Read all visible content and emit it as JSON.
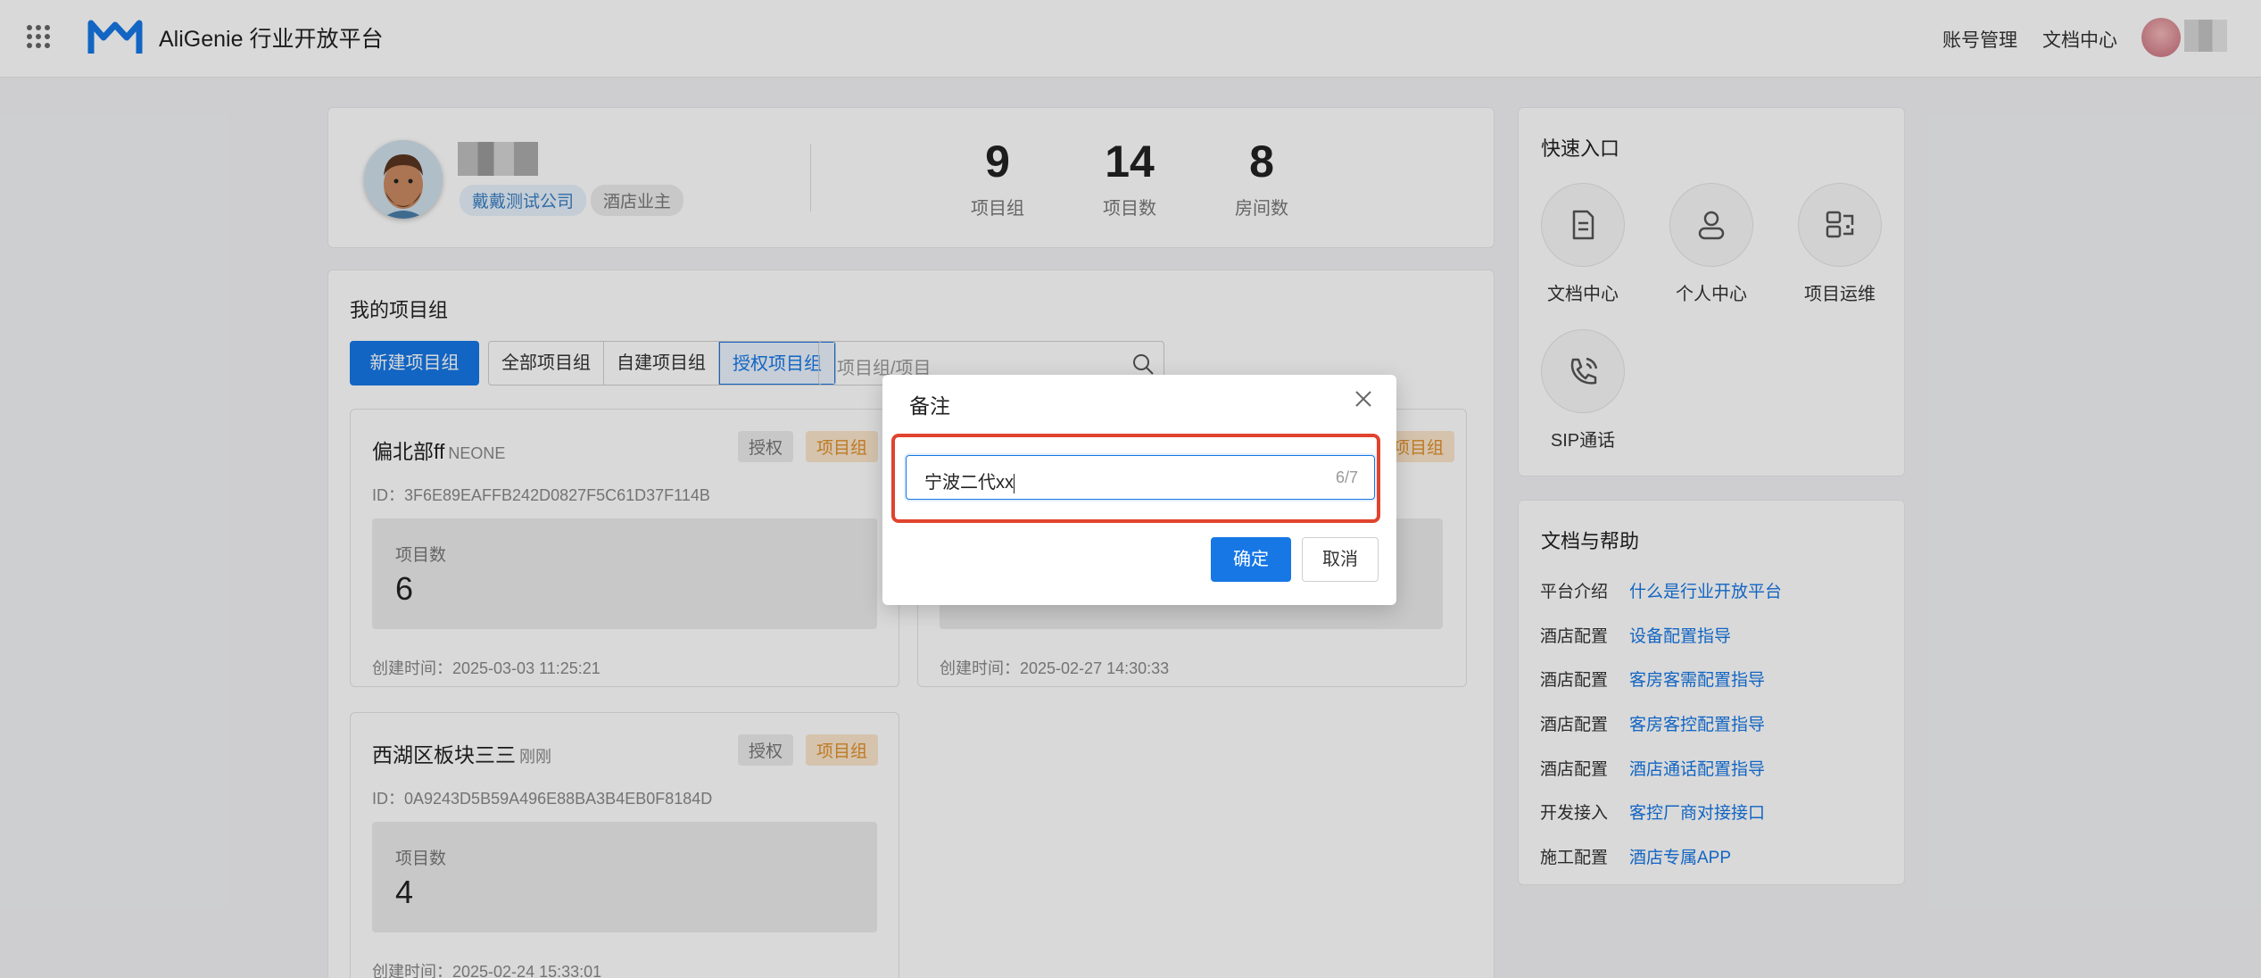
{
  "header": {
    "brand": "AliGenie 行业开放平台",
    "links": [
      "账号管理",
      "文档中心"
    ]
  },
  "profile": {
    "company": "戴戴测试公司",
    "role": "酒店业主",
    "stats": [
      {
        "value": "9",
        "label": "项目组"
      },
      {
        "value": "14",
        "label": "项目数"
      },
      {
        "value": "8",
        "label": "房间数"
      }
    ]
  },
  "projects": {
    "title": "我的项目组",
    "new_button": "新建项目组",
    "filters": [
      "全部项目组",
      "自建项目组",
      "授权项目组"
    ],
    "active_filter": "授权项目组",
    "search_placeholder": "项目组/项目",
    "cards": [
      {
        "name": "偏北部ff",
        "note": "NEONE",
        "badge_auth": "授权",
        "badge_group": "项目组",
        "id": "ID：3F6E89EAFFB242D0827F5C61D37F114B",
        "count_label": "项目数",
        "count": "6",
        "created": "创建时间：2025-03-03 11:25:21"
      },
      {
        "name": "",
        "note": "",
        "badge_auth": "",
        "badge_group": "项目组",
        "id": "",
        "count_label": "",
        "count": "",
        "created": "创建时间：2025-02-27 14:30:33"
      },
      {
        "name": "西湖区板块三三",
        "note": "刚刚",
        "badge_auth": "授权",
        "badge_group": "项目组",
        "id": "ID：0A9243D5B59A496E88BA3B4EB0F8184D",
        "count_label": "项目数",
        "count": "4",
        "created": "创建时间：2025-02-24 15:33:01"
      }
    ]
  },
  "quick": {
    "title": "快速入口",
    "items": [
      {
        "label": "文档中心",
        "icon": "document-icon"
      },
      {
        "label": "个人中心",
        "icon": "user-icon"
      },
      {
        "label": "项目运维",
        "icon": "devices-icon"
      },
      {
        "label": "SIP通话",
        "icon": "phone-call-icon"
      }
    ]
  },
  "help": {
    "title": "文档与帮助",
    "rows": [
      {
        "k": "平台介绍",
        "v": "什么是行业开放平台"
      },
      {
        "k": "酒店配置",
        "v": "设备配置指导"
      },
      {
        "k": "酒店配置",
        "v": "客房客需配置指导"
      },
      {
        "k": "酒店配置",
        "v": "客房客控配置指导"
      },
      {
        "k": "酒店配置",
        "v": "酒店通话配置指导"
      },
      {
        "k": "开发接入",
        "v": "客控厂商对接接口"
      },
      {
        "k": "施工配置",
        "v": "酒店专属APP"
      }
    ]
  },
  "modal": {
    "title": "备注",
    "input_value": "宁波二代xx",
    "counter": "6/7",
    "confirm": "确定",
    "cancel": "取消"
  },
  "colors": {
    "primary": "#1677e5",
    "highlight": "#e0442e",
    "group_badge": "#e0902a"
  }
}
